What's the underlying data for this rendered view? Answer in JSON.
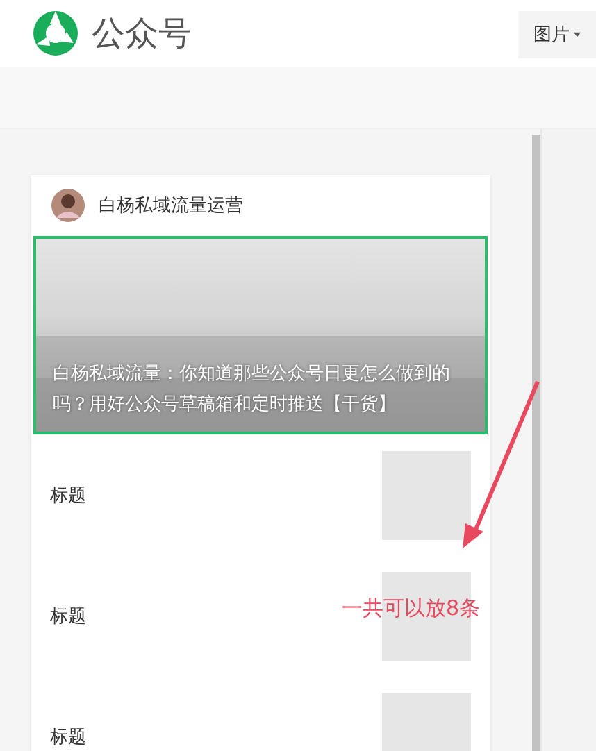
{
  "header": {
    "logo_text": "公众号",
    "menu_button": "图片"
  },
  "article_card": {
    "account_name": "白杨私域流量运营",
    "cover": {
      "title": "白杨私域流量：你知道那些公众号日更怎么做到的吗？用好公众号草稿箱和定时推送【干货】"
    },
    "items": [
      {
        "title": "标题"
      },
      {
        "title": "标题"
      },
      {
        "title": "标题"
      }
    ]
  },
  "annotation": "一共可以放8条"
}
